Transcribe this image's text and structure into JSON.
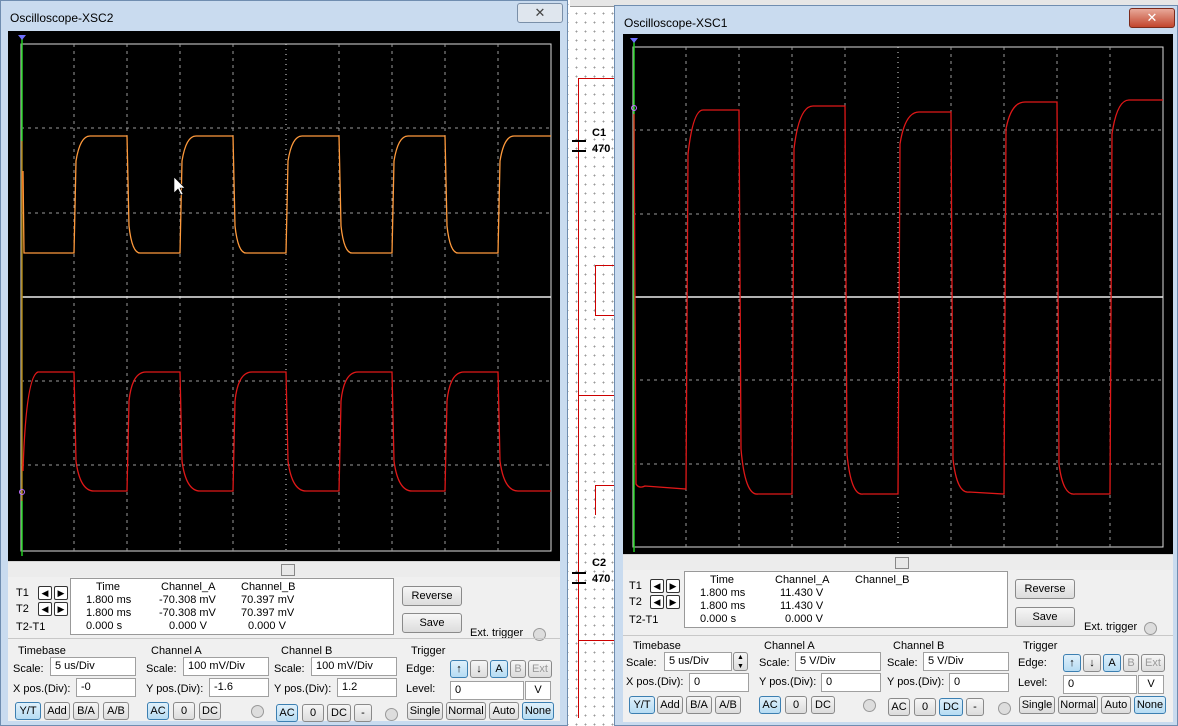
{
  "schematic": {
    "c1_name": "C1",
    "c1_value": "470",
    "c2_name": "C2",
    "c2_value": "470"
  },
  "windows": [
    {
      "title": "Oscilloscope-XSC2",
      "close_glyph": "✕",
      "readout": {
        "headers": [
          "Time",
          "Channel_A",
          "Channel_B"
        ],
        "rows": [
          {
            "label": "T1",
            "time": "1.800 ms",
            "a": "-70.308 mV",
            "b": "70.397 mV"
          },
          {
            "label": "T2",
            "time": "1.800 ms",
            "a": "-70.308 mV",
            "b": "70.397 mV"
          },
          {
            "label": "T2-T1",
            "time": "0.000 s",
            "a": "0.000 V",
            "b": "0.000 V"
          }
        ]
      },
      "reverse_label": "Reverse",
      "save_label": "Save",
      "ext_trigger_label": "Ext. trigger",
      "timebase": {
        "title": "Timebase",
        "scale_label": "Scale:",
        "scale": "5 us/Div",
        "pos_label": "X pos.(Div):",
        "pos": "-0",
        "buttons": [
          "Y/T",
          "Add",
          "B/A",
          "A/B"
        ]
      },
      "channel_a": {
        "title": "Channel A",
        "scale_label": "Scale:",
        "scale": "100 mV/Div",
        "pos_label": "Y pos.(Div):",
        "pos": "-1.6",
        "buttons": [
          "AC",
          "0",
          "DC"
        ]
      },
      "channel_b": {
        "title": "Channel B",
        "scale_label": "Scale:",
        "scale": "100 mV/Div",
        "pos_label": "Y pos.(Div):",
        "pos": "1.2",
        "buttons": [
          "AC",
          "0",
          "DC",
          "-"
        ]
      },
      "trigger": {
        "title": "Trigger",
        "edge_label": "Edge:",
        "level_label": "Level:",
        "level": "0",
        "unit": "V",
        "edge_buttons": [
          "↑",
          "↓",
          "A",
          "B",
          "Ext"
        ],
        "mode_buttons": [
          "Single",
          "Normal",
          "Auto",
          "None"
        ]
      },
      "colors": {
        "trace_a": "#ff9a3c",
        "trace_b": "#e01818"
      }
    },
    {
      "title": "Oscilloscope-XSC1",
      "close_glyph": "✕",
      "readout": {
        "headers": [
          "Time",
          "Channel_A",
          "Channel_B"
        ],
        "rows": [
          {
            "label": "T1",
            "time": "1.800 ms",
            "a": "11.430 V",
            "b": ""
          },
          {
            "label": "T2",
            "time": "1.800 ms",
            "a": "11.430 V",
            "b": ""
          },
          {
            "label": "T2-T1",
            "time": "0.000 s",
            "a": "0.000 V",
            "b": ""
          }
        ]
      },
      "reverse_label": "Reverse",
      "save_label": "Save",
      "ext_trigger_label": "Ext. trigger",
      "timebase": {
        "title": "Timebase",
        "scale_label": "Scale:",
        "scale": "5 us/Div",
        "pos_label": "X pos.(Div):",
        "pos": "0",
        "buttons": [
          "Y/T",
          "Add",
          "B/A",
          "A/B"
        ]
      },
      "channel_a": {
        "title": "Channel A",
        "scale_label": "Scale:",
        "scale": "5  V/Div",
        "pos_label": "Y pos.(Div):",
        "pos": "0",
        "buttons": [
          "AC",
          "0",
          "DC"
        ]
      },
      "channel_b": {
        "title": "Channel B",
        "scale_label": "Scale:",
        "scale": "5  V/Div",
        "pos_label": "Y pos.(Div):",
        "pos": "0",
        "buttons": [
          "AC",
          "0",
          "DC",
          "-"
        ]
      },
      "trigger": {
        "title": "Trigger",
        "edge_label": "Edge:",
        "level_label": "Level:",
        "level": "0",
        "unit": "V",
        "edge_buttons": [
          "↑",
          "↓",
          "A",
          "B",
          "Ext"
        ],
        "mode_buttons": [
          "Single",
          "Normal",
          "Auto",
          "None"
        ]
      },
      "colors": {
        "trace_a": "#e01818"
      }
    }
  ]
}
